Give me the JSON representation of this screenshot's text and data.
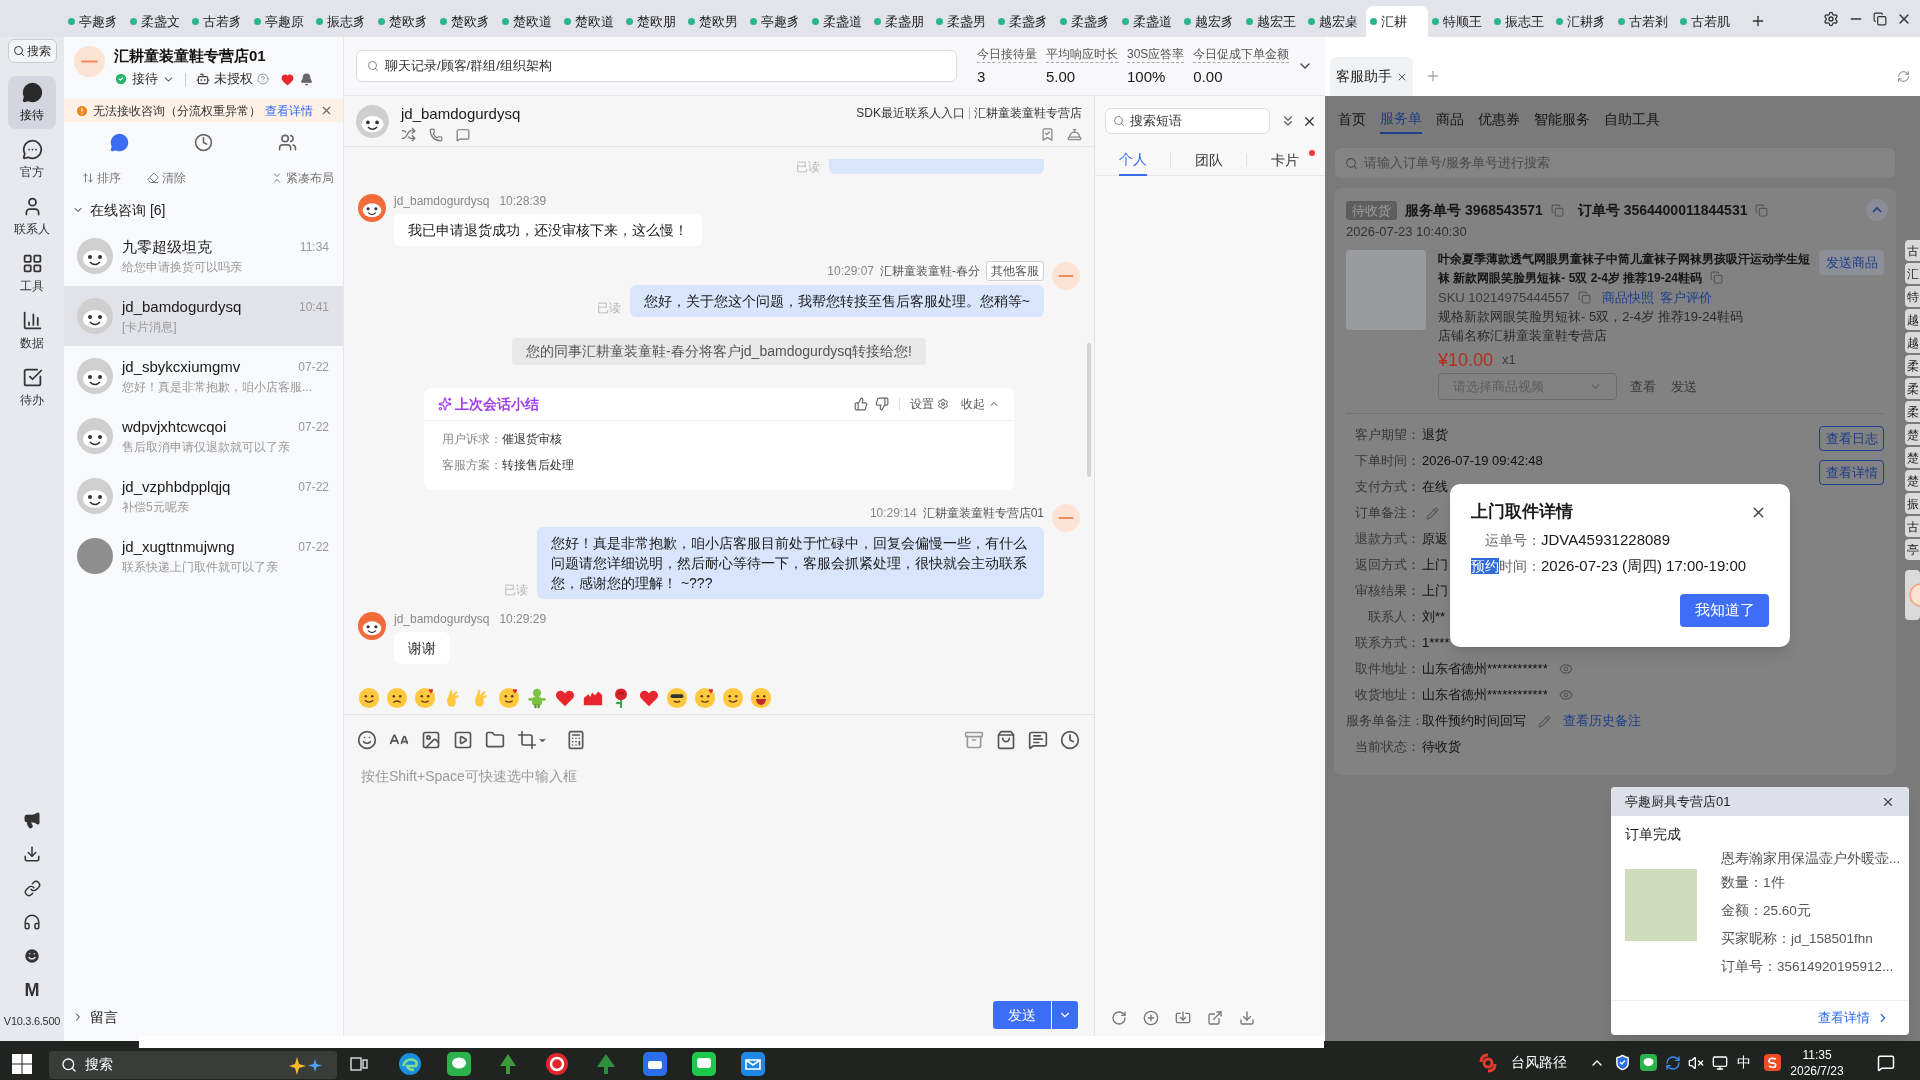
{
  "top_tabs": [
    {
      "label": "亭趣豸",
      "selected": false
    },
    {
      "label": "柔盏文",
      "selected": false
    },
    {
      "label": "古若豸",
      "selected": false
    },
    {
      "label": "亭趣原",
      "selected": false
    },
    {
      "label": "振志豸",
      "selected": false
    },
    {
      "label": "楚欧豸",
      "selected": false
    },
    {
      "label": "楚欧豸",
      "selected": false
    },
    {
      "label": "楚欧道",
      "selected": false
    },
    {
      "label": "楚欧道",
      "selected": false
    },
    {
      "label": "楚欧朋",
      "selected": false
    },
    {
      "label": "楚欧男",
      "selected": false
    },
    {
      "label": "亭趣豸",
      "selected": false
    },
    {
      "label": "柔盏道",
      "selected": false
    },
    {
      "label": "柔盏朋",
      "selected": false
    },
    {
      "label": "柔盏男",
      "selected": false
    },
    {
      "label": "柔盏豸",
      "selected": false
    },
    {
      "label": "柔盏豸",
      "selected": false
    },
    {
      "label": "柔盏道",
      "selected": false
    },
    {
      "label": "越宏豸",
      "selected": false
    },
    {
      "label": "越宏王",
      "selected": false
    },
    {
      "label": "越宏桌",
      "selected": false
    },
    {
      "label": "汇耕",
      "selected": true
    },
    {
      "label": "特顺王",
      "selected": false
    },
    {
      "label": "振志王",
      "selected": false
    },
    {
      "label": "汇耕豸",
      "selected": false
    },
    {
      "label": "古若剎",
      "selected": false
    },
    {
      "label": "古若肌",
      "selected": false
    }
  ],
  "nav_rail": {
    "search": "搜索",
    "items": [
      {
        "label": "接待",
        "selected": true
      },
      {
        "label": "官方",
        "selected": false
      },
      {
        "label": "联系人",
        "selected": false
      },
      {
        "label": "工具",
        "selected": false
      },
      {
        "label": "数据",
        "selected": false
      },
      {
        "label": "待办",
        "selected": false
      }
    ],
    "logo_letter": "M",
    "version": "V10.3.6.500"
  },
  "shop_header": {
    "name": "汇耕童装童鞋专营店01",
    "status": "接待",
    "authorization": "未授权"
  },
  "alert": {
    "text": "无法接收咨询（分流权重异常）",
    "link": "查看详情"
  },
  "list_tabs": [
    {
      "selected": true
    },
    {
      "selected": false
    },
    {
      "selected": false
    }
  ],
  "list_actions": [
    "排序",
    "清除",
    "紧凑布局"
  ],
  "online_group": {
    "label": "在线咨询 [6]",
    "expanded": true
  },
  "conversations": [
    {
      "name": "九零超级坦克",
      "time": "11:34",
      "preview": "给您申请换货可以吗亲",
      "selected": false,
      "kind": "mascot"
    },
    {
      "name": "jd_bamdogurdysq",
      "time": "10:41",
      "preview": "[卡片消息]",
      "selected": true,
      "kind": "mascot"
    },
    {
      "name": "jd_sbykcxiumgmv",
      "time": "07-22",
      "preview": "您好！真是非常抱歉，咱小店客服...",
      "selected": false,
      "kind": "mascot"
    },
    {
      "name": "wdpvjxhtcwcqoi",
      "time": "07-22",
      "preview": "售后取消申请仅退款就可以了亲",
      "selected": false,
      "kind": "mascot"
    },
    {
      "name": "jd_vzphbdpplqjq",
      "time": "07-22",
      "preview": "补偿5元呢亲",
      "selected": false,
      "kind": "mascot"
    },
    {
      "name": "jd_xugttnmujwng",
      "time": "07-22",
      "preview": "联系快递上门取件就可以了亲",
      "selected": false,
      "kind": "photo"
    }
  ],
  "message_group": {
    "label": "留言",
    "expanded": false
  },
  "search": {
    "placeholder": "聊天记录/顾客/群组/组织架构"
  },
  "stats": [
    {
      "label": "今日接待量",
      "value": "3"
    },
    {
      "label": "平均响应时长",
      "value": "5.00"
    },
    {
      "label": "30S应答率",
      "value": "100%"
    },
    {
      "label": "今日促成下单金额",
      "value": "0.00"
    }
  ],
  "chat": {
    "customer": "jd_bamdogurdysq",
    "sdk_link": "SDK最近联系人入口",
    "store": "汇耕童装童鞋专营店",
    "messages": [
      {
        "kind": "clipped",
        "read": "已读"
      },
      {
        "kind": "customer",
        "name": "jd_bamdogurdysq",
        "time": "10:28:39",
        "text": "我已申请退货成功，还没审核下来，这么慢！"
      },
      {
        "kind": "agent",
        "time": "10:29:07",
        "name": "汇耕童装童鞋-春分",
        "tag": "其他客服",
        "text": "您好，关于您这个问题，我帮您转接至售后客服处理。您稍等~",
        "read": "已读"
      },
      {
        "kind": "system",
        "text": "您的同事汇耕童装童鞋-春分将客户jd_bamdogurdysq转接给您!"
      },
      {
        "kind": "summary",
        "title": "上次会话小结",
        "settings": "设置",
        "collapse": "收起",
        "rows": [
          {
            "label": "用户诉求：",
            "value": "催退货审核"
          },
          {
            "label": "客服方案：",
            "value": "转接售后处理"
          }
        ]
      },
      {
        "kind": "agent",
        "time": "10:29:14",
        "name": "汇耕童装童鞋专营店01",
        "text": "您好！真是非常抱歉，咱小店客服目前处于忙碌中，回复会偏慢一些，有什么问题请您详细说明，然后耐心等待一下，客服会抓紧处理，很快就会主动联系您，感谢您的理解！ ~???",
        "read": "已读"
      },
      {
        "kind": "customer",
        "name": "jd_bamdogurdysq",
        "time": "10:29:29",
        "text": "谢谢"
      }
    ],
    "input": {
      "placeholder": "按住Shift+Space可快速选中输入框"
    },
    "send": "发送"
  },
  "quick_replies": {
    "search": {
      "placeholder": "搜索短语"
    },
    "tabs": [
      {
        "label": "个人",
        "selected": true,
        "dot": false
      },
      {
        "label": "团队",
        "selected": false,
        "dot": false
      },
      {
        "label": "卡片",
        "selected": false,
        "dot": true
      }
    ]
  },
  "assistant": {
    "tab": "客服助手",
    "nav": [
      {
        "label": "首页",
        "selected": false
      },
      {
        "label": "服务单",
        "selected": true
      },
      {
        "label": "商品",
        "selected": false
      },
      {
        "label": "优惠券",
        "selected": false
      },
      {
        "label": "智能服务",
        "selected": false
      },
      {
        "label": "自助工具",
        "selected": false
      }
    ],
    "search": {
      "placeholder": "请输入订单号/服务单号进行搜索"
    },
    "order": {
      "status": "待收货",
      "service_no": "服务单号 3968543571",
      "order_no": "订单号 3564400011844531",
      "created": "2026-07-23 10:40:30",
      "title": "叶余夏季薄款透气网眼男童袜子中筒儿童袜子网袜男孩吸汗运动学生短袜 新款网眼笑脸男短袜- 5双 2-4岁 推荐19-24鞋码",
      "send_product": "发送商品",
      "sku": "SKU 10214975444557",
      "links": [
        "商品快照",
        "客户评价"
      ],
      "spec": "规格新款网眼笑脸男短袜- 5双，2-4岁 推荐19-24鞋码",
      "shop": "店铺名称汇耕童装童鞋专营店",
      "price": "¥10.00",
      "quantity": "x1",
      "video_select": {
        "placeholder": "请选择商品视频"
      },
      "video_actions": [
        "查看",
        "发送"
      ],
      "buttons": [
        "查看日志",
        "查看详情"
      ],
      "fields": [
        {
          "label": "客户期望：",
          "value": "退货",
          "kind": "plain"
        },
        {
          "label": "下单时间：",
          "value": "2026-07-19 09:42:48",
          "kind": "plain"
        },
        {
          "label": "支付方式：",
          "value": "在线",
          "kind": "plain"
        },
        {
          "label": "订单备注：",
          "kind": "edit"
        },
        {
          "label": "退款方式：",
          "value": "原返",
          "kind": "plain"
        },
        {
          "label": "返回方式：",
          "value": "上门",
          "kind": "plain"
        },
        {
          "label": "审核结果：",
          "value": "上门",
          "kind": "plain"
        },
        {
          "label": "联系人：",
          "value": "刘**",
          "kind": "plain"
        },
        {
          "label": "联系方式：",
          "value": "1****",
          "kind": "plain"
        },
        {
          "label": "取件地址：",
          "value": "山东省德州************",
          "kind": "reveal"
        },
        {
          "label": "收货地址：",
          "value": "山东省德州************",
          "kind": "reveal"
        },
        {
          "label": "服务单备注：",
          "value": "取件预约时间回写",
          "kind": "note",
          "link": "查看历史备注"
        },
        {
          "label": "当前状态：",
          "value": "待收货",
          "kind": "plain"
        }
      ]
    }
  },
  "side_tabs": [
    "古",
    "汇",
    "特",
    "越",
    "越",
    "柔",
    "柔",
    "柔",
    "楚",
    "楚",
    "楚",
    "振",
    "古",
    "亭"
  ],
  "pickup_dialog": {
    "title": "上门取件详情",
    "rows": [
      {
        "label": "运单号：",
        "value": "JDVA45931228089"
      },
      {
        "selected_text": "预约",
        "label": "时间：",
        "value": "2026-07-23 (周四) 17:00-19:00"
      }
    ],
    "button": "我知道了"
  },
  "notification": {
    "shop": "亭趣厨具专营店01",
    "title": "订单完成",
    "product": "恩寿瀚家用保温壶户外暖壶...",
    "rows": [
      "数量：1件",
      "金额：25.60元",
      "买家昵称：jd_158501fhn",
      "订单号：35614920195912..."
    ],
    "link": "查看详情"
  },
  "taskbar": {
    "search": "搜索",
    "weather": "台风路径",
    "ime": "中",
    "time": "11:35",
    "date": "2026/7/23"
  }
}
